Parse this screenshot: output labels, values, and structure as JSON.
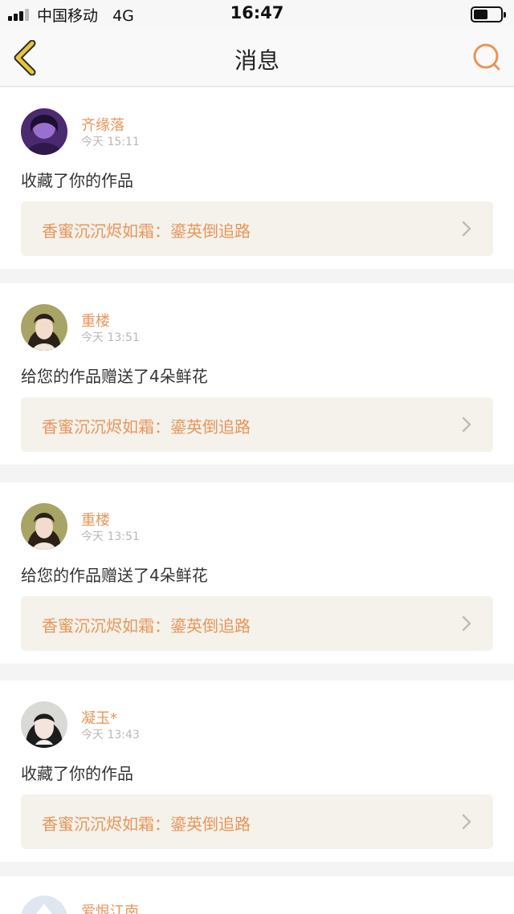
{
  "status_bar": {
    "carrier": "中国移动",
    "network": "4G",
    "time": "16:47"
  },
  "header": {
    "title": "消息"
  },
  "messages": [
    {
      "user": "齐缘落",
      "time": "今天 15:11",
      "action": "收藏了你的作品",
      "work": "香蜜沉沉烬如霜：鎏英倒追路"
    },
    {
      "user": "重楼",
      "time": "今天 13:51",
      "action": "给您的作品赠送了4朵鲜花",
      "work": "香蜜沉沉烬如霜：鎏英倒追路"
    },
    {
      "user": "重楼",
      "time": "今天 13:51",
      "action": "给您的作品赠送了4朵鲜花",
      "work": "香蜜沉沉烬如霜：鎏英倒追路"
    },
    {
      "user": "凝玉*",
      "time": "今天 13:43",
      "action": "收藏了你的作品",
      "work": "香蜜沉沉烬如霜：鎏英倒追路"
    },
    {
      "user": "爱恨江南"
    }
  ],
  "colors": {
    "accent": "#e8955a",
    "back_icon": "#e7c53a",
    "link_bg": "#f4f2ea"
  },
  "icons": {
    "back": "chevron-left-icon",
    "search": "search-icon",
    "item": "chevron-right-icon"
  }
}
